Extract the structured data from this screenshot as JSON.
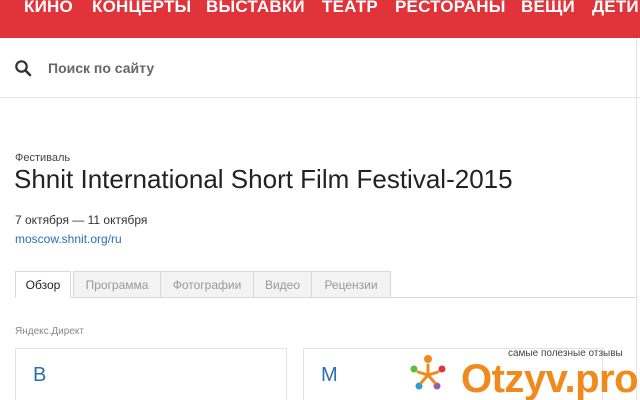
{
  "topnav": {
    "items": [
      "КИНО",
      "КОНЦЕРТЫ",
      "ВЫСТАВКИ",
      "ТЕАТР",
      "РЕСТОРАНЫ",
      "ВЕЩИ",
      "ДЕТИ"
    ],
    "color": "#e0333a"
  },
  "search": {
    "placeholder": "Поиск по сайту",
    "value": ""
  },
  "event": {
    "category": "Фестиваль",
    "title": "Shnit International Short Film Festival-2015",
    "dates": "7 октября — 11 октября",
    "link": "moscow.shnit.org/ru"
  },
  "tabs": [
    {
      "label": "Обзор",
      "active": true
    },
    {
      "label": "Программа",
      "active": false
    },
    {
      "label": "Фотографии",
      "active": false
    },
    {
      "label": "Видео",
      "active": false
    },
    {
      "label": "Рецензии",
      "active": false
    }
  ],
  "ads": {
    "label": "Яндекс.Директ",
    "cards": [
      "В",
      "М"
    ]
  },
  "watermark": {
    "caption": "самые полезные отзывы",
    "logo": "Otzyv.pro"
  }
}
